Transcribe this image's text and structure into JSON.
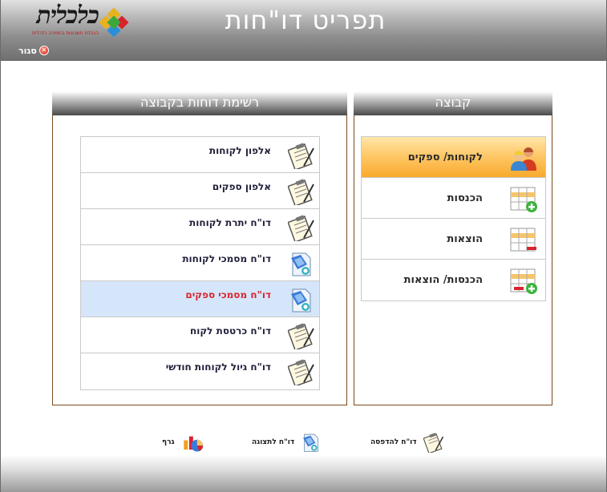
{
  "header": {
    "title": "תפריט דו\"חות",
    "logo_text": "כלכלית",
    "logo_subtitle": "הנהלת חשבונות בתמיכה כלכלית",
    "close_label": "סגור"
  },
  "groups_panel": {
    "title": "קבוצה",
    "items": [
      {
        "label": "לקוחות/ ספקים",
        "icon": "customers-suppliers-icon",
        "selected": true
      },
      {
        "label": "הכנסות",
        "icon": "income-table-icon",
        "selected": false
      },
      {
        "label": "הוצאות",
        "icon": "expenses-table-icon",
        "selected": false
      },
      {
        "label": "הכנסות/ הוצאות",
        "icon": "income-expenses-table-icon",
        "selected": false
      }
    ]
  },
  "reports_panel": {
    "title": "רשימת דוחות בקבוצה",
    "items": [
      {
        "label": "אלפון לקוחות",
        "icon": "clipboard-icon"
      },
      {
        "label": "אלפון ספקים",
        "icon": "clipboard-icon"
      },
      {
        "label": "דו\"ח יתרת לקוחות",
        "icon": "clipboard-icon"
      },
      {
        "label": "דו\"ח מסמכי לקוחות",
        "icon": "document-view-icon"
      },
      {
        "label": "דו\"ח מסמכי ספקים",
        "icon": "document-view-icon",
        "highlight": true
      },
      {
        "label": "דו\"ח כרטסת לקוח",
        "icon": "clipboard-icon"
      },
      {
        "label": "דו\"ח גיול לקוחות חודשי",
        "icon": "clipboard-icon"
      }
    ]
  },
  "footer": {
    "print_label": "דו\"ח להדפסה",
    "view_label": "דו\"ח לתצוגה",
    "graph_label": "גרף"
  },
  "colors": {
    "selected_group": "#f8a92c",
    "highlight_row": "#d6e6fa",
    "highlight_text": "#d8242e",
    "panel_border": "#7a4a1e"
  }
}
